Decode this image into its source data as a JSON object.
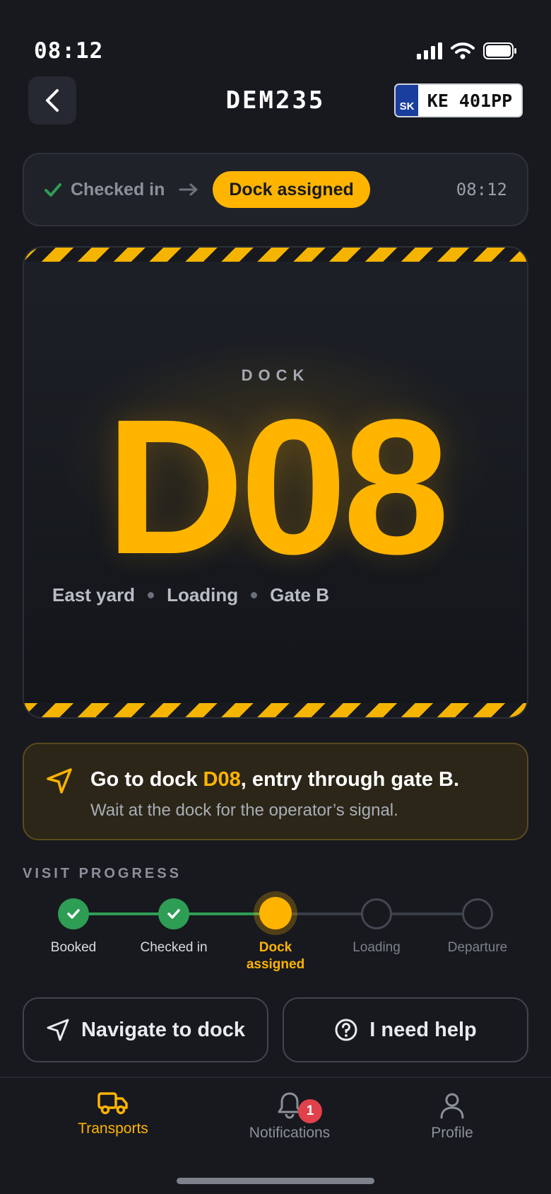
{
  "status_bar": {
    "time": "08:12"
  },
  "header": {
    "vehicle_id": "DEM235",
    "plate_country": "SK",
    "plate_number": "KE 401PP"
  },
  "status": {
    "previous": "Checked in",
    "current": "Dock assigned",
    "time": "08:12"
  },
  "dock": {
    "label": "DOCK",
    "code": "D08",
    "meta": [
      "East yard",
      "Loading",
      "Gate B"
    ]
  },
  "instruction": {
    "title_prefix": "Go to dock ",
    "dock": "D08",
    "title_suffix": ", entry through gate B.",
    "subtitle": "Wait at the dock for the operator’s signal."
  },
  "progress": {
    "title": "VISIT PROGRESS",
    "steps": [
      {
        "label": "Booked",
        "state": "done"
      },
      {
        "label": "Checked in",
        "state": "done"
      },
      {
        "label": "Dock\nassigned",
        "state": "current"
      },
      {
        "label": "Loading",
        "state": "pending"
      },
      {
        "label": "Departure",
        "state": "pending"
      }
    ]
  },
  "actions": {
    "navigate": "Navigate to dock",
    "help": "I need help"
  },
  "tabs": {
    "transports": "Transports",
    "notifications": "Notifications",
    "notifications_badge": "1",
    "profile": "Profile"
  },
  "colors": {
    "accent": "#ffb400",
    "success": "#2e9e55",
    "badge": "#e0414b",
    "background": "#17191f"
  }
}
